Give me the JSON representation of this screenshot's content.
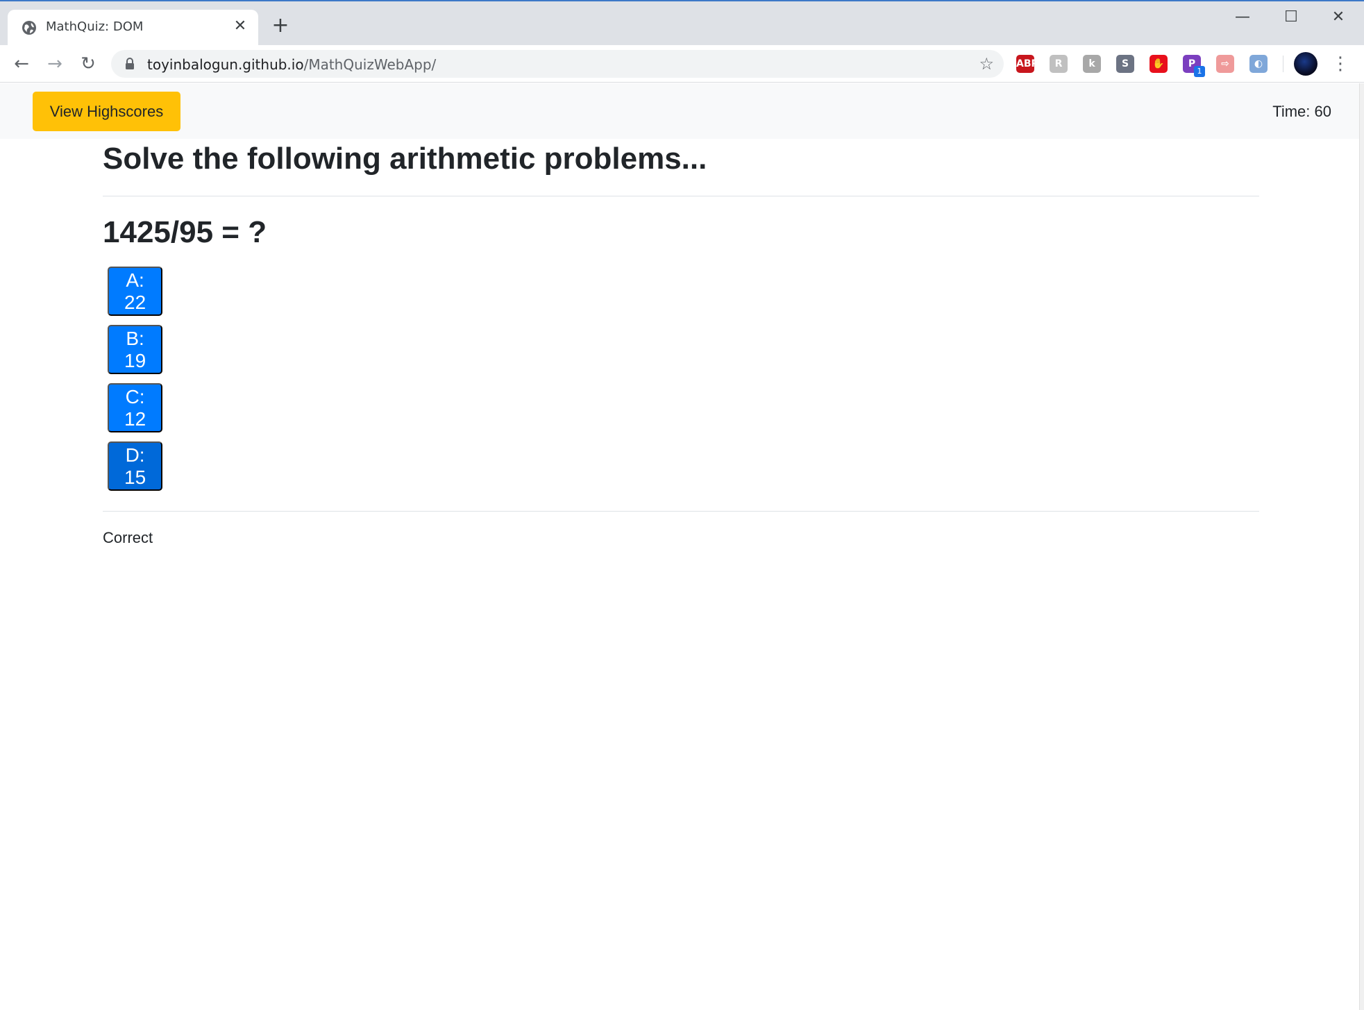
{
  "browser": {
    "tab": {
      "title": "MathQuiz: DOM",
      "close": "✕"
    },
    "new_tab": "+",
    "window_controls": {
      "minimize": "—",
      "maximize": "☐",
      "close": "✕"
    },
    "nav": {
      "back": "←",
      "forward": "→",
      "reload": "↻"
    },
    "address": {
      "host": "toyinbalogun.github.io",
      "path": "/MathQuizWebApp/"
    },
    "bookmark_star": "☆",
    "extensions": [
      {
        "name": "adblock-extension-icon",
        "label": "ABP",
        "color": "#c8161d"
      },
      {
        "name": "extension-r-icon",
        "label": "R",
        "color": "#c0c0c0"
      },
      {
        "name": "extension-k-icon",
        "label": "k",
        "color": "#a8a8a8"
      },
      {
        "name": "extension-s-icon",
        "label": "S",
        "color": "#6c7383"
      },
      {
        "name": "ublock-hand-icon",
        "label": "✋",
        "color": "#e8101c"
      },
      {
        "name": "extension-p-icon",
        "label": "P",
        "color": "#7b3fbf",
        "badge": "1"
      },
      {
        "name": "extension-arrow-icon",
        "label": "⇨",
        "color": "#ef9a9a"
      },
      {
        "name": "extension-circle-icon",
        "label": "◐",
        "color": "#7fa7d9"
      }
    ],
    "menu": "⋮"
  },
  "navbar": {
    "highscores_label": "View Highscores",
    "timer": "Time: 60"
  },
  "quiz": {
    "heading": "Solve the following arithmetic problems...",
    "question": "1425/95 = ?",
    "answers": [
      "A: 22",
      "B: 19",
      "C: 12",
      "D: 15"
    ],
    "feedback": "Correct"
  }
}
